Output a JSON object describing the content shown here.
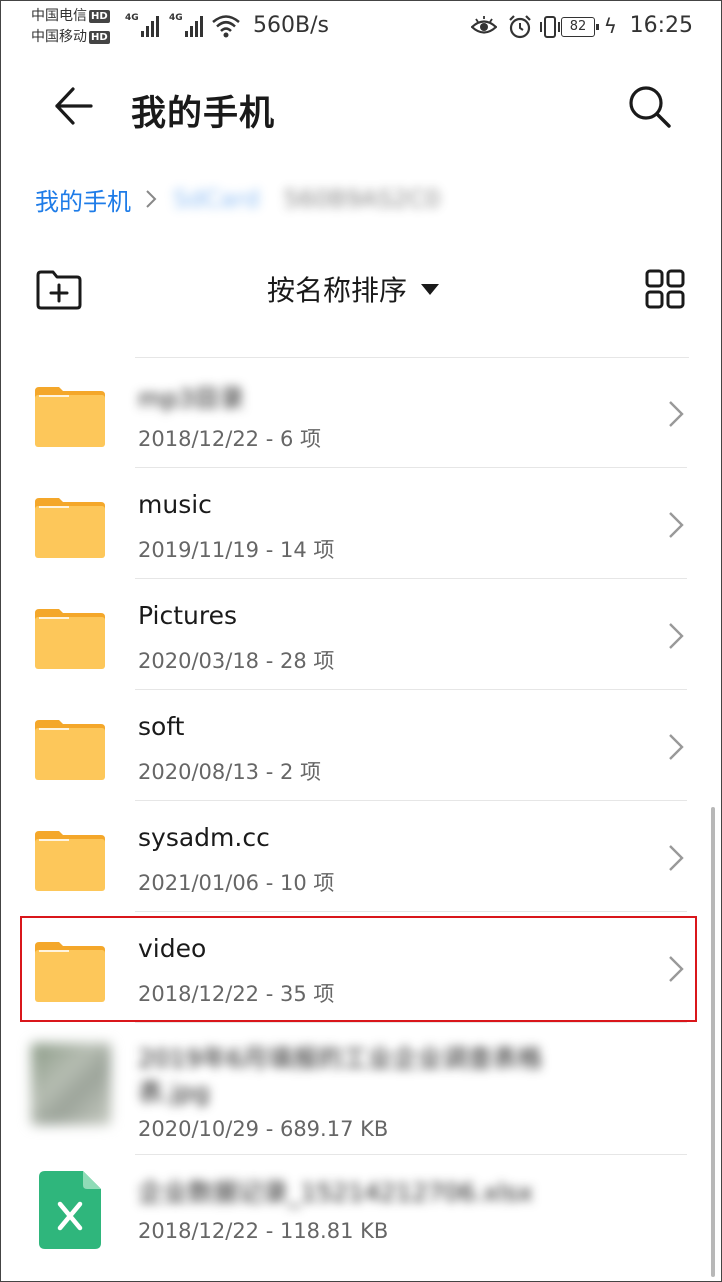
{
  "status_bar": {
    "carrier1": "中国电信",
    "carrier2": "中国移动",
    "hd_label": "HD",
    "network1": "4G",
    "network2": "4G",
    "net_speed": "560B/s",
    "battery": "82",
    "time": "16:25"
  },
  "header": {
    "title": "我的手机",
    "back_icon": "arrow-left-icon",
    "search_icon": "search-icon"
  },
  "breadcrumb": {
    "home": "我的手机",
    "segment1": "SdCard",
    "segment2": "560B9AS2C0"
  },
  "toolbar": {
    "sort_label": "按名称排序",
    "new_folder_icon": "new-folder-icon",
    "grid_icon": "grid-view-icon"
  },
  "files": [
    {
      "name": "mp3目录",
      "meta": "2018/12/22 - 6 项",
      "type": "folder",
      "blurred": true
    },
    {
      "name": "music",
      "meta": "2019/11/19 - 14 项",
      "type": "folder"
    },
    {
      "name": "Pictures",
      "meta": "2020/03/18 - 28 项",
      "type": "folder"
    },
    {
      "name": "soft",
      "meta": "2020/08/13 - 2 项",
      "type": "folder"
    },
    {
      "name": "sysadm.cc",
      "meta": "2021/01/06 - 10 项",
      "type": "folder"
    },
    {
      "name": "video",
      "meta": "2018/12/22 - 35 项",
      "type": "folder",
      "highlighted": true
    },
    {
      "name": "2019年6月填报的工业企业调查表格",
      "name_line2": "表.jpg",
      "meta": "2020/10/29 - 689.17 KB",
      "type": "image",
      "blurred": true
    },
    {
      "name": "企业数据记录_15214212706.xlsx",
      "meta": "2018/12/22 - 118.81 KB",
      "type": "xlsx",
      "blurred": true
    }
  ],
  "colors": {
    "accent": "#1e7ce8",
    "folder": "#fdc75a",
    "folder_tab": "#f4a72a",
    "highlight": "#d9161b",
    "xlsx": "#2fb67c"
  }
}
